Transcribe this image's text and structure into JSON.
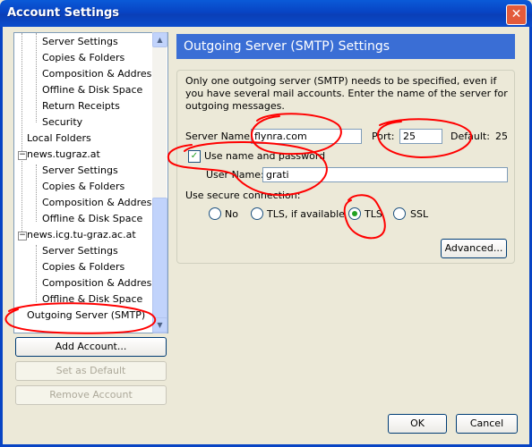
{
  "window": {
    "title": "Account Settings",
    "close_glyph": "✕"
  },
  "tree": {
    "items": [
      "Server Settings",
      "Copies & Folders",
      "Composition & Addres…",
      "Offline & Disk Space",
      "Return Receipts",
      "Security",
      "Local Folders",
      "news.tugraz.at",
      "Server Settings",
      "Copies & Folders",
      "Composition & Addres…",
      "Offline & Disk Space",
      "news.icg.tu-graz.ac.at",
      "Server Settings",
      "Copies & Folders",
      "Composition & Addres…",
      "Offline & Disk Space",
      "Outgoing Server (SMTP)"
    ],
    "expander_minus": "−"
  },
  "scrollbar": {
    "up_glyph": "▲",
    "down_glyph": "▼"
  },
  "buttons": {
    "add_account": "Add Account...",
    "set_default": "Set as Default",
    "remove_account": "Remove Account",
    "ok": "OK",
    "cancel": "Cancel",
    "advanced": "Advanced..."
  },
  "smtp": {
    "header": "Outgoing Server (SMTP) Settings",
    "description": "Only one outgoing server (SMTP) needs to be specified, even if you have several mail accounts. Enter the name of the server for outgoing messages.",
    "server_name_label": "Server Name:",
    "server_name_value": "flynra.com",
    "port_label": "Port:",
    "port_value": "25",
    "default_label": "Default:",
    "default_value": "25",
    "use_auth_label": "Use name and password",
    "use_auth_checked": true,
    "user_name_label": "User Name:",
    "user_name_value": "grati",
    "secure_label": "Use secure connection:",
    "secure_options": [
      "No",
      "TLS, if available",
      "TLS",
      "SSL"
    ],
    "secure_selected": "TLS"
  },
  "icons": {
    "check": "✓"
  },
  "colors": {
    "titlebar": "#0844c4",
    "header": "#3a6ed5",
    "annotation": "#ff0000",
    "radio_selected": "#21a121"
  }
}
